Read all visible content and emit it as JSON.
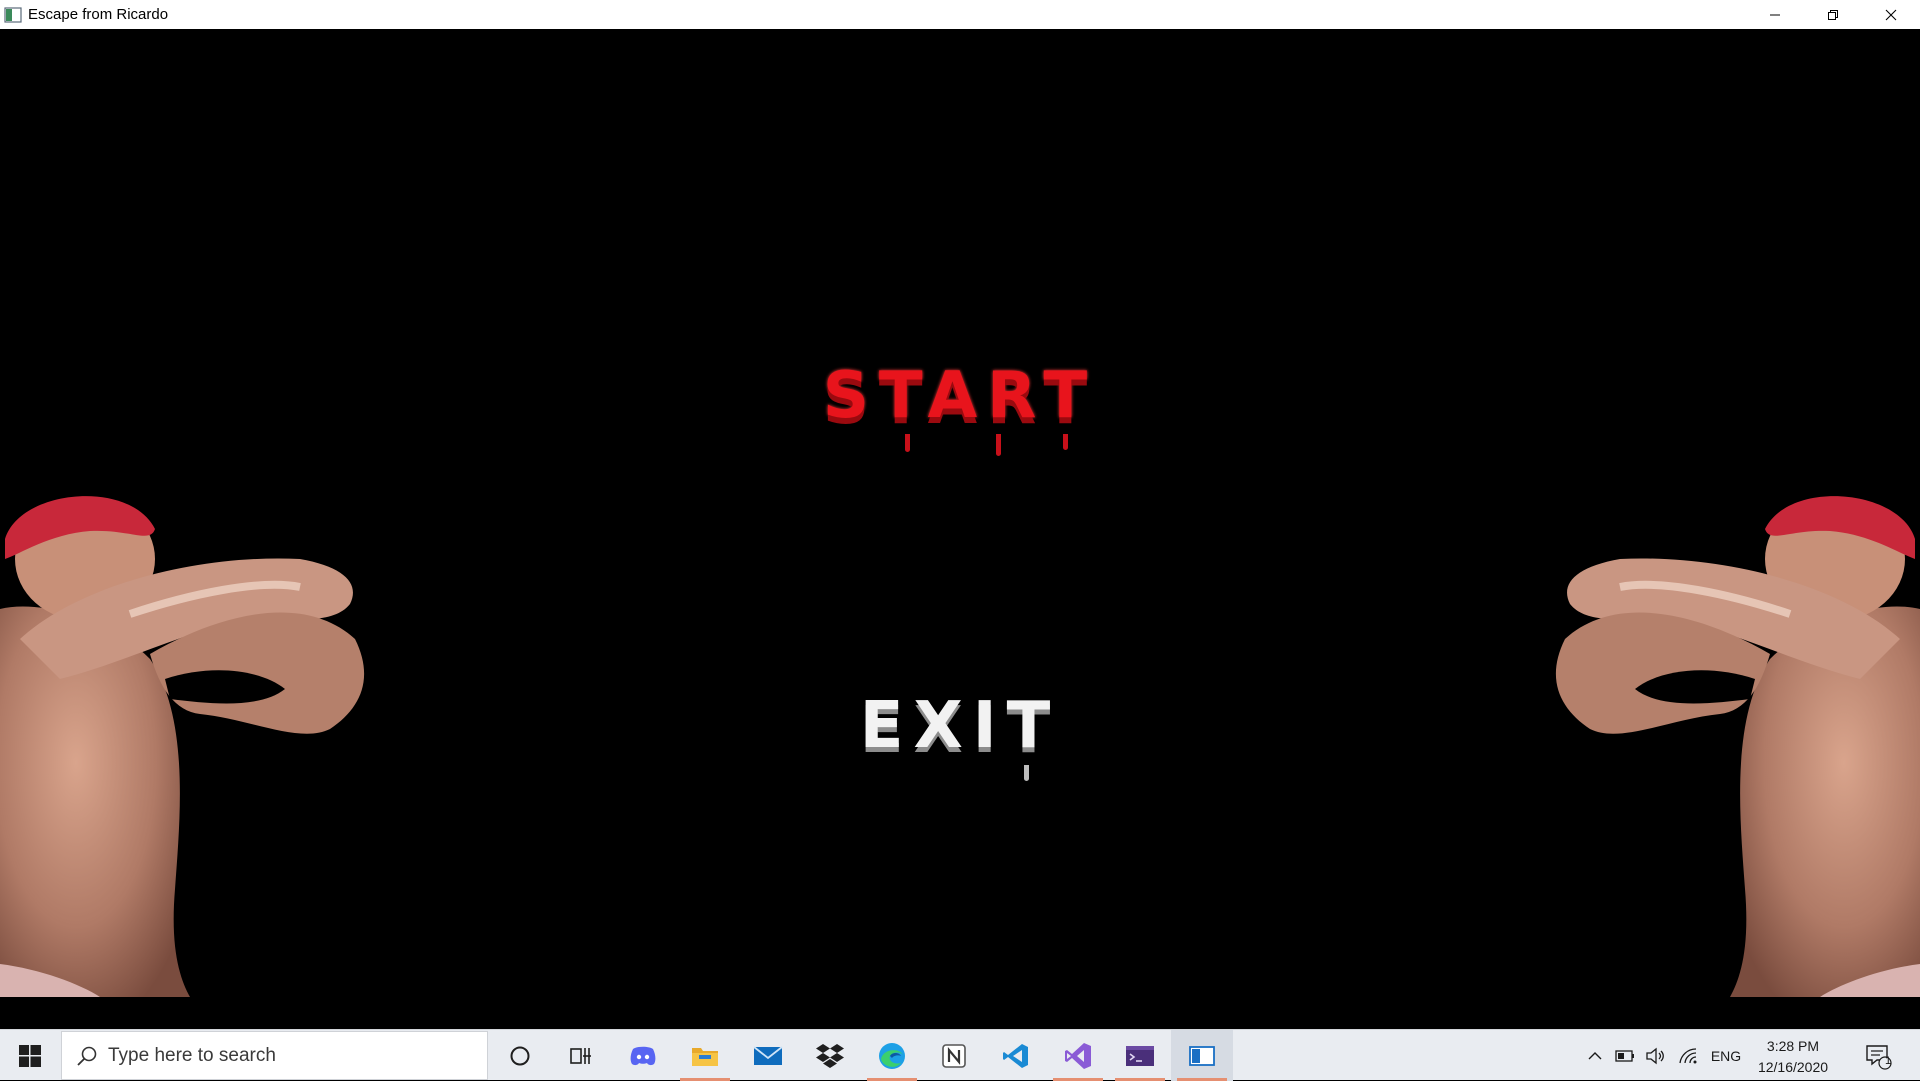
{
  "window": {
    "title": "Escape from Ricardo"
  },
  "menu": {
    "start_label": "START",
    "exit_label": "EXIT",
    "start_color": "#e8141c",
    "exit_color": "#f2f2f2"
  },
  "taskbar": {
    "search_placeholder": "Type here to search",
    "apps": [
      "cortana",
      "task-view",
      "discord",
      "file-explorer",
      "mail",
      "dropbox",
      "edge",
      "notion",
      "vscode",
      "visual-studio",
      "terminal",
      "game-window"
    ],
    "tray": {
      "language": "ENG",
      "time": "3:28 PM",
      "date": "12/16/2020",
      "notification_count": "1"
    }
  }
}
